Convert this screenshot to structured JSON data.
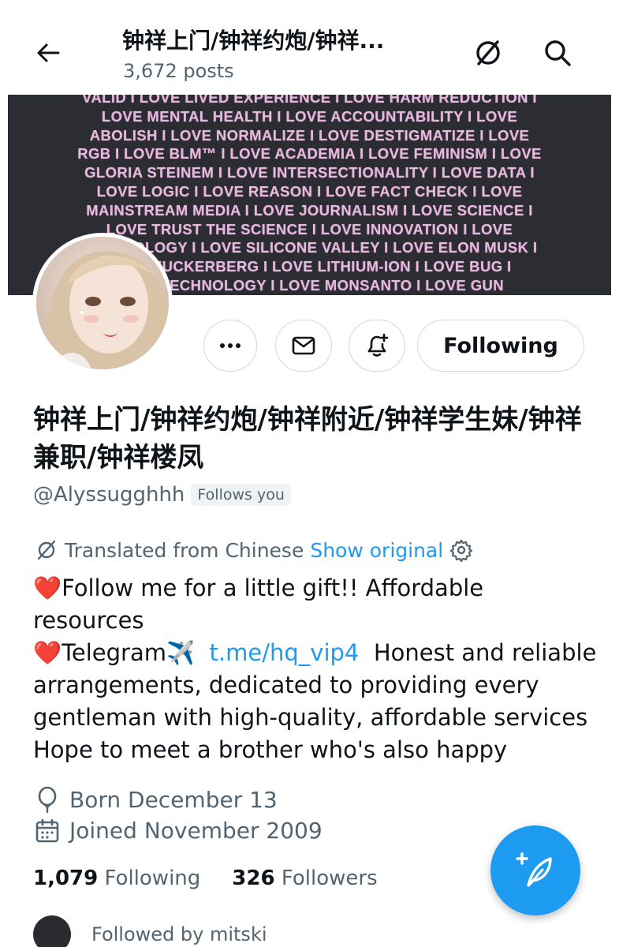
{
  "header": {
    "title": "钟祥上门/钟祥约炮/钟祥...",
    "posts_count": "3,672 posts"
  },
  "banner": {
    "lines": [
      "VALID I LOVE LIVED EXPERIENCE I LOVE HARM REDUCTION I",
      "LOVE MENTAL HEALTH I LOVE ACCOUNTABILITY I LOVE",
      "ABOLISH I LOVE NORMALIZE I LOVE DESTIGMATIZE I LOVE",
      "RGB I LOVE BLM™ I LOVE ACADEMIA I LOVE FEMINISM I LOVE",
      "GLORIA STEINEM I LOVE INTERSECTIONALITY I LOVE DATA I",
      "LOVE LOGIC I LOVE REASON I LOVE FACT CHECK I LOVE",
      "MAINSTREAM MEDIA I LOVE JOURNALISM I LOVE SCIENCE I",
      "LOVE TRUST THE SCIENCE I LOVE INNOVATION I LOVE",
      "TECHNOLOGY I LOVE SILICONE VALLEY I LOVE ELON MUSK I",
      "LOVE ZUCKERBERG I LOVE LITHIUM-ION I LOVE BUG I",
      "LOVE TECHNOLOGY I LOVE MONSANTO I LOVE GUN"
    ]
  },
  "profile": {
    "display_name": "钟祥上门/钟祥约炮/钟祥附近/钟祥学生妹/钟祥兼职/钟祥楼凤",
    "handle": "@Alyssugghhh",
    "follows_you": "Follows you",
    "following_button": "Following"
  },
  "translation": {
    "label": "Translated from Chinese",
    "show_original": "Show original"
  },
  "bio": {
    "heart1": "❤️",
    "part1": "Follow me for a little gift!! Affordable resources",
    "heart2": "❤️",
    "part2": "Telegram",
    "plane": "✈️",
    "link": "t.me/hq_vip4",
    "part3": "Honest and reliable arrangements, dedicated to providing every gentleman with high-quality, affordable services      Hope to meet a brother who's also happy"
  },
  "meta": {
    "born": "Born December 13",
    "joined": "Joined November 2009"
  },
  "stats": {
    "following_count": "1,079",
    "following_label": "Following",
    "followers_count": "326",
    "followers_label": "Followers"
  },
  "followed_by": "Followed by mitski",
  "colors": {
    "accent": "#1d9bf0",
    "text_primary": "#0f1419",
    "text_secondary": "#536471",
    "banner_bg": "#2b2d33",
    "banner_text": "#e6b9dd"
  }
}
